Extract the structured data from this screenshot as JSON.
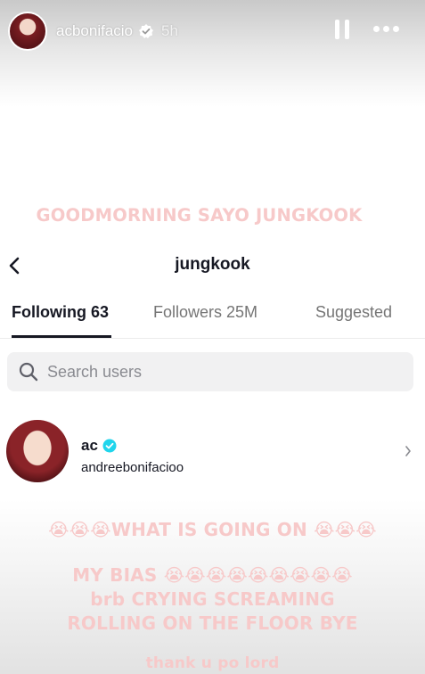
{
  "story": {
    "username": "acbonifacio",
    "time": "5h",
    "texts": {
      "goodmorning": "GOODMORNING SAYO JUNGKOOK",
      "what_going_prefix": "😭😭😭",
      "what_going": "WHAT IS GOING ON",
      "what_going_suffix": "😭😭😭",
      "my_bias": "MY BIAS",
      "my_bias_emojis": "😭😭😭😭😭😭😭😭😭",
      "brb": "brb CRYING SCREAMING",
      "rolling": "ROLLING ON THE FLOOR BYE",
      "thanku": "thank u po lord"
    }
  },
  "profile": {
    "title": "jungkook",
    "tabs": [
      {
        "label": "Following 63"
      },
      {
        "label": "Followers 25M"
      },
      {
        "label": "Suggested"
      }
    ],
    "search": {
      "placeholder": "Search users"
    },
    "user": {
      "name": "ac",
      "handle": "andreebonifacioo"
    }
  },
  "colors": {
    "overlay_text": "#f7c9c9",
    "verified": "#20d5ec",
    "primary_text": "#161823"
  }
}
